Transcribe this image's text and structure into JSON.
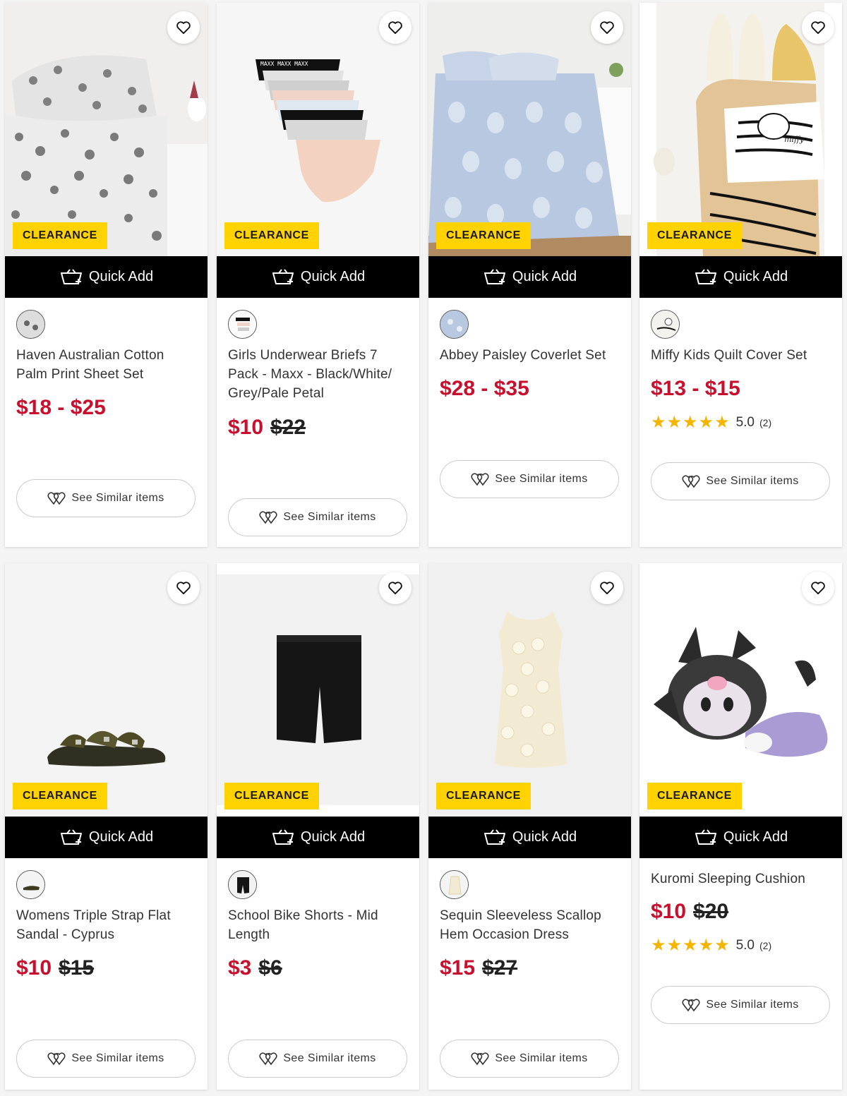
{
  "labels": {
    "badge": "CLEARANCE",
    "quick_add": "Quick Add",
    "see_similar": "See Similar items"
  },
  "colors": {
    "price_red": "#c8102e",
    "badge_yellow": "#ffd200",
    "star": "#f4b400"
  },
  "products": [
    {
      "title": "Haven Australian Cotton Palm Print Sheet Set",
      "price": "$18 - $25",
      "was": "",
      "badge": true
    },
    {
      "title": "Girls Underwear Briefs 7 Pack - Maxx - Black/White/ Grey/Pale Petal",
      "price": "$10",
      "was": "$22",
      "badge": true,
      "print_text": "MAXX MAXX MAXX"
    },
    {
      "title": "Abbey Paisley Coverlet Set",
      "price": "$28 - $35",
      "was": "",
      "badge": true
    },
    {
      "title": "Miffy Kids Quilt Cover Set",
      "price": "$13 - $15",
      "was": "",
      "badge": true,
      "rating": "5.0",
      "rating_count": "(2)",
      "stars": 5,
      "print_text": "miffy"
    },
    {
      "title": "Womens Triple Strap Flat Sandal - Cyprus",
      "price": "$10",
      "was": "$15",
      "badge": true
    },
    {
      "title": "School Bike Shorts - Mid Length",
      "price": "$3",
      "was": "$6",
      "badge": true
    },
    {
      "title": "Sequin Sleeveless Scallop Hem Occasion Dress",
      "price": "$15",
      "was": "$27",
      "badge": true
    },
    {
      "title": "Kuromi Sleeping Cushion",
      "price": "$10",
      "was": "$20",
      "badge": true,
      "rating": "5.0",
      "rating_count": "(2)",
      "stars": 5
    }
  ],
  "icons": {
    "favorite": "heart-outline-icon",
    "cart": "basket-plus-icon",
    "similar": "hearts-icon",
    "star": "star-icon"
  }
}
